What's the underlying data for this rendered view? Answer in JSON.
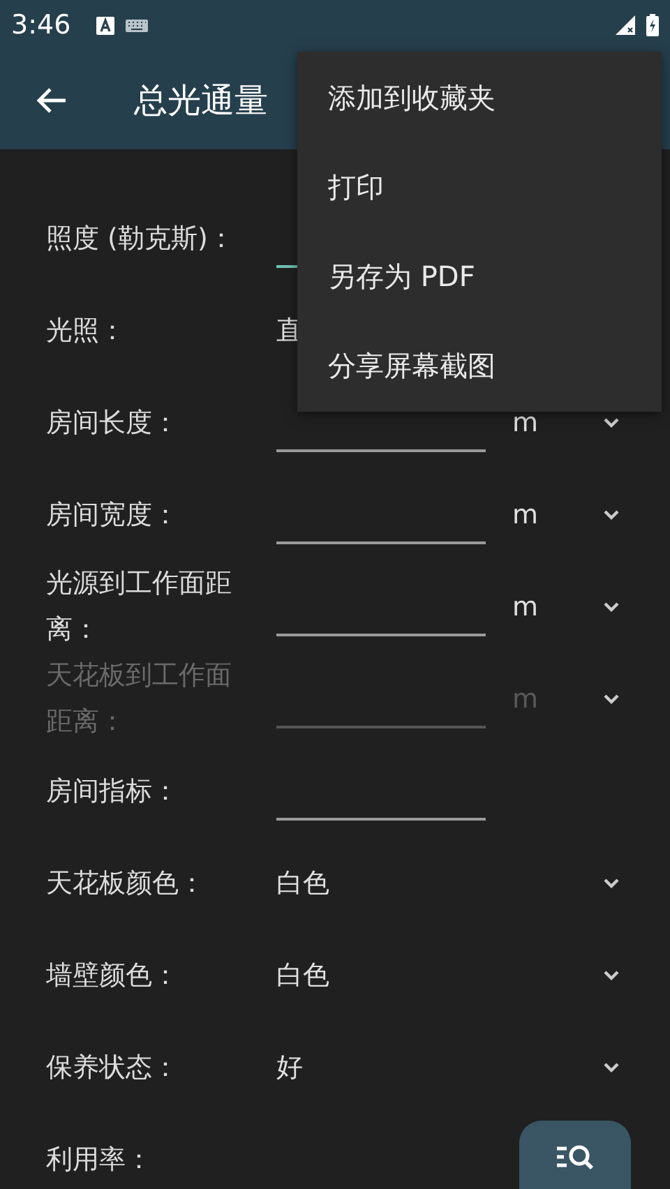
{
  "status_bar": {
    "time": "3:46"
  },
  "app_bar": {
    "title": "总光通量"
  },
  "rows": [
    {
      "kind": "input",
      "label": "照度 (勒克斯)：",
      "focused": true,
      "disabled": false,
      "dropdown": false
    },
    {
      "kind": "select",
      "label": "光照：",
      "value": "直",
      "disabled": false,
      "dropdown": false
    },
    {
      "kind": "input",
      "label": "房间长度：",
      "unit": "m",
      "focused": false,
      "disabled": false,
      "dropdown": true
    },
    {
      "kind": "input",
      "label": "房间宽度：",
      "unit": "m",
      "focused": false,
      "disabled": false,
      "dropdown": true
    },
    {
      "kind": "input",
      "label": "光源到工作面距离：",
      "unit": "m",
      "focused": false,
      "disabled": false,
      "dropdown": true
    },
    {
      "kind": "input",
      "label": "天花板到工作面距离：",
      "unit": "m",
      "focused": false,
      "disabled": true,
      "dropdown": true
    },
    {
      "kind": "input",
      "label": "房间指标：",
      "focused": false,
      "disabled": false,
      "dropdown": false
    },
    {
      "kind": "select",
      "label": "天花板颜色：",
      "value": "白色",
      "disabled": false,
      "dropdown": true
    },
    {
      "kind": "select",
      "label": "墙壁颜色：",
      "value": "白色",
      "disabled": false,
      "dropdown": true
    },
    {
      "kind": "select",
      "label": "保养状态：",
      "value": "好",
      "disabled": false,
      "dropdown": true
    },
    {
      "kind": "action",
      "label": "利用率："
    }
  ],
  "menu": {
    "items": [
      "添加到收藏夹",
      "打印",
      "另存为 PDF",
      "分享屏幕截图"
    ]
  }
}
